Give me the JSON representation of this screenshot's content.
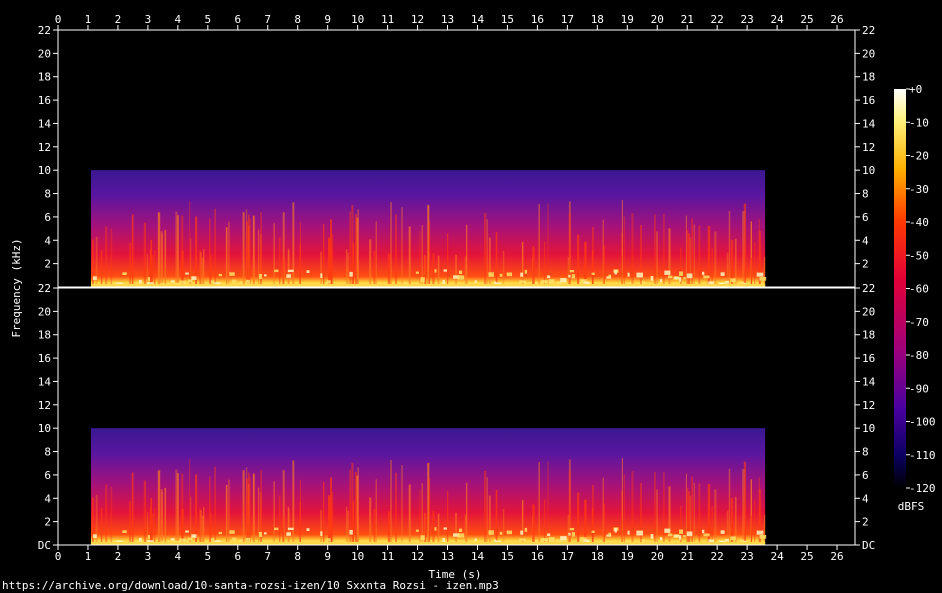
{
  "chart_data": {
    "type": "heatmap",
    "xlabel": "Time (s)",
    "ylabel": "Frequency (kHz)",
    "x_ticks": [
      0,
      1,
      2,
      3,
      4,
      5,
      6,
      7,
      8,
      9,
      10,
      11,
      12,
      13,
      14,
      15,
      16,
      17,
      18,
      19,
      20,
      21,
      22,
      23,
      24,
      25,
      26
    ],
    "xlim": [
      0,
      26.6
    ],
    "y_ticks": [
      "DC",
      "2",
      "4",
      "6",
      "8",
      "10",
      "12",
      "14",
      "16",
      "18",
      "20",
      "22"
    ],
    "ylim": [
      0,
      22
    ],
    "channels": [
      {
        "name": "top-channel"
      },
      {
        "name": "bottom-channel"
      }
    ],
    "signal": {
      "start_s": 1.1,
      "end_s": 23.6,
      "max_freq_khz": 10
    },
    "colorbar": {
      "label": "dBFS",
      "ticks": [
        "+0",
        "-10",
        "-20",
        "-30",
        "-40",
        "-50",
        "-60",
        "-70",
        "-80",
        "-90",
        "-100",
        "-110",
        "-120"
      ],
      "range": [
        -120,
        0
      ]
    }
  },
  "footer": {
    "source": "https://archive.org/download/10-santa-rozsi-izen/10 Sxxnta Rozsi - izen.mp3"
  }
}
